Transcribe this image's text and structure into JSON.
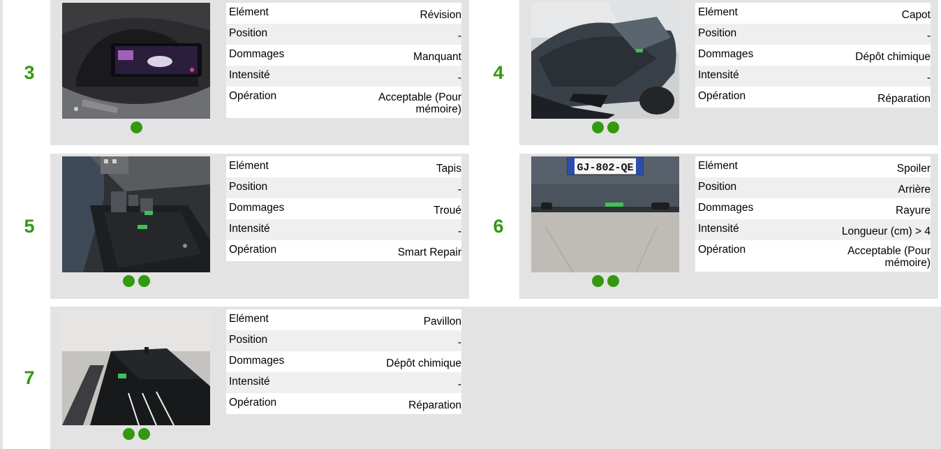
{
  "field_labels": {
    "element": "Elément",
    "position": "Position",
    "dommages": "Dommages",
    "intensite": "Intensité",
    "operation": "Opération"
  },
  "cards": [
    {
      "number": "3",
      "element": "Révision",
      "position": "-",
      "dommages": "Manquant",
      "intensite": "-",
      "operation": "Acceptable (Pour mémoire)",
      "photo": "dashboard-instrument-cluster-photo",
      "dot_count": 1
    },
    {
      "number": "4",
      "element": "Capot",
      "position": "-",
      "dommages": "Dépôt chimique",
      "intensite": "-",
      "operation": "Réparation",
      "photo": "car-hood-photo",
      "dot_count": 2
    },
    {
      "number": "5",
      "element": "Tapis",
      "position": "-",
      "dommages": "Troué",
      "intensite": "-",
      "operation": "Smart Repair",
      "photo": "floor-mat-pedals-photo",
      "dot_count": 2
    },
    {
      "number": "6",
      "element": "Spoiler",
      "position": "Arrière",
      "dommages": "Rayure",
      "intensite": "Longueur (cm) > 4",
      "operation": "Acceptable (Pour mémoire)",
      "photo": "rear-bumper-plate-photo",
      "plate_text": "GJ-802-QE",
      "dot_count": 2
    },
    {
      "number": "7",
      "element": "Pavillon",
      "position": "-",
      "dommages": "Dépôt chimique",
      "intensite": "-",
      "operation": "Réparation",
      "photo": "car-roof-photo",
      "dot_count": 2
    }
  ],
  "colors": {
    "number_green": "#339911",
    "dot_green": "#339911",
    "card_bg": "#e3e3e3"
  }
}
